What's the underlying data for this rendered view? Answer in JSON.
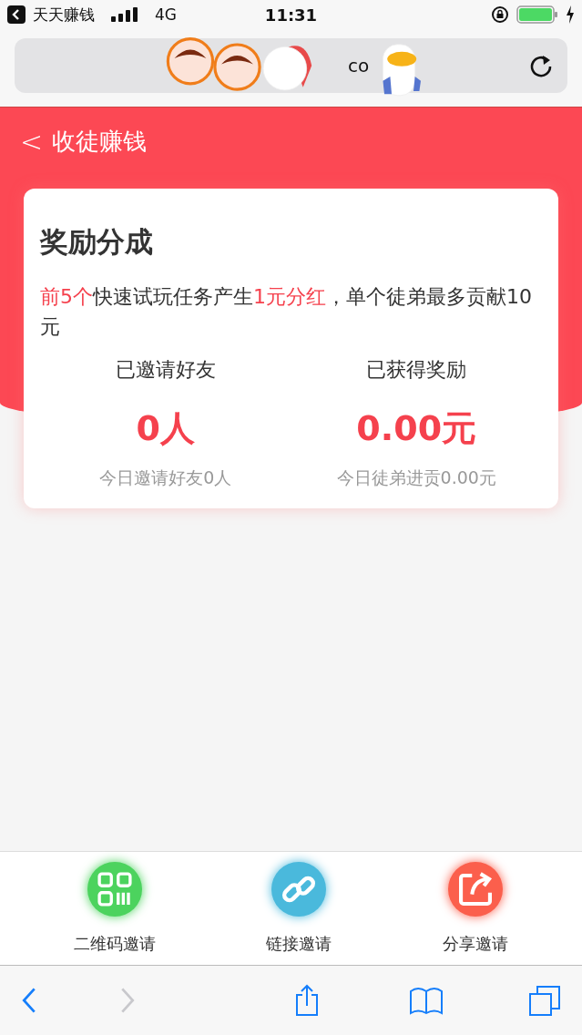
{
  "status_bar": {
    "back_app": "天天赚钱",
    "network": "4G",
    "time": "11:31"
  },
  "browser": {
    "url": "co"
  },
  "nav": {
    "back": "<",
    "title": "收徒赚钱"
  },
  "card": {
    "title": "奖励分成",
    "description_parts": [
      {
        "text": "前5个",
        "highlight": true
      },
      {
        "text": "快速试玩任务产生",
        "highlight": false
      },
      {
        "text": "1元分红",
        "highlight": true
      },
      {
        "text": "，单个徒弟最多贡献10元",
        "highlight": false
      }
    ],
    "stats": [
      {
        "label": "已邀请好友",
        "value": "0人",
        "note": "今日邀请好友0人"
      },
      {
        "label": "已获得奖励",
        "value": "0.00元",
        "note": "今日徒弟进贡0.00元"
      }
    ]
  },
  "actions": [
    {
      "kind": "qrcode",
      "label": "二维码邀请",
      "color": "#4cd35e"
    },
    {
      "kind": "link",
      "label": "链接邀请",
      "color": "#4ab9dc"
    },
    {
      "kind": "share",
      "label": "分享邀请",
      "color": "#fb5f4c"
    }
  ],
  "toolbar": [
    {
      "kind": "back",
      "disabled": false
    },
    {
      "kind": "forward",
      "disabled": true
    },
    {
      "kind": "share",
      "disabled": false
    },
    {
      "kind": "bookmarks",
      "disabled": false
    },
    {
      "kind": "tabs",
      "disabled": false
    }
  ]
}
